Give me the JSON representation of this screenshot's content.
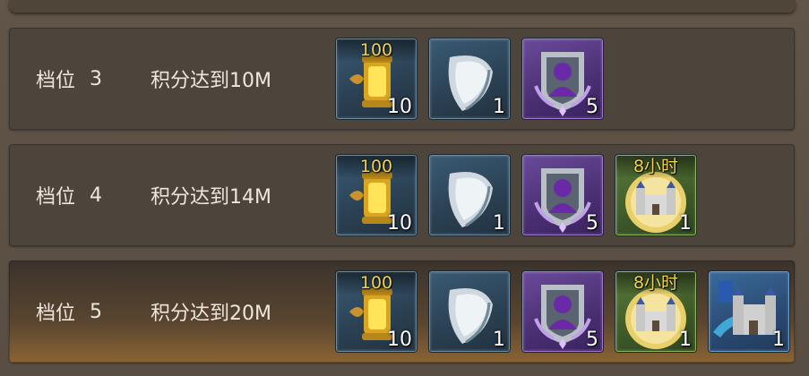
{
  "rows": [
    {
      "tier_label": "档位",
      "tier_num": "3",
      "condition": "积分达到10M",
      "items": [
        {
          "icon": "golden-lantern-icon",
          "rarity": "blue",
          "top": "100",
          "qty": "10"
        },
        {
          "icon": "silver-shield-icon",
          "rarity": "blue",
          "top": "",
          "qty": "1"
        },
        {
          "icon": "avatar-badge-icon",
          "rarity": "purple",
          "top": "",
          "qty": "5"
        }
      ]
    },
    {
      "tier_label": "档位",
      "tier_num": "4",
      "condition": "积分达到14M",
      "items": [
        {
          "icon": "golden-lantern-icon",
          "rarity": "blue",
          "top": "100",
          "qty": "10"
        },
        {
          "icon": "silver-shield-icon",
          "rarity": "blue",
          "top": "",
          "qty": "1"
        },
        {
          "icon": "avatar-badge-icon",
          "rarity": "purple",
          "top": "",
          "qty": "5"
        },
        {
          "icon": "castle-speedup-icon",
          "rarity": "green",
          "top": "8小时",
          "qty": "1"
        }
      ]
    },
    {
      "tier_label": "档位",
      "tier_num": "5",
      "condition": "积分达到20M",
      "items": [
        {
          "icon": "golden-lantern-icon",
          "rarity": "blue",
          "top": "100",
          "qty": "10"
        },
        {
          "icon": "silver-shield-icon",
          "rarity": "blue",
          "top": "",
          "qty": "1"
        },
        {
          "icon": "avatar-badge-icon",
          "rarity": "purple",
          "top": "",
          "qty": "5"
        },
        {
          "icon": "castle-speedup-icon",
          "rarity": "green",
          "top": "8小时",
          "qty": "1"
        },
        {
          "icon": "castle-skin-icon",
          "rarity": "skyblue",
          "top": "",
          "qty": "1"
        }
      ]
    }
  ]
}
